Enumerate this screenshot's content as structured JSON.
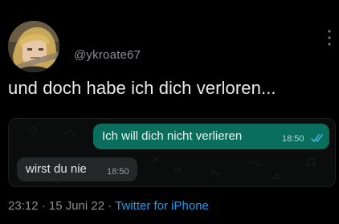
{
  "tweet": {
    "handle": "@ykroate67",
    "text": "und doch habe ich dich verloren...",
    "timestamp": "23:12 · 15 Juni 22 · ",
    "source": "Twitter for iPhone"
  },
  "chat": {
    "outgoing": {
      "text": "Ich will dich nicht verlieren",
      "time": "18:50",
      "status_icon": "double-check-icon"
    },
    "incoming": {
      "text": "wirst du nie",
      "time": "18:50"
    }
  },
  "icons": {
    "more": "vertical-ellipsis-icon",
    "avatar": "anime-character-avatar"
  },
  "colors": {
    "background": "#000000",
    "link": "#1d9bf0",
    "outgoing_bubble": "#0a6e5c",
    "incoming_bubble": "#232727",
    "read_ticks": "#4fb6ec"
  }
}
